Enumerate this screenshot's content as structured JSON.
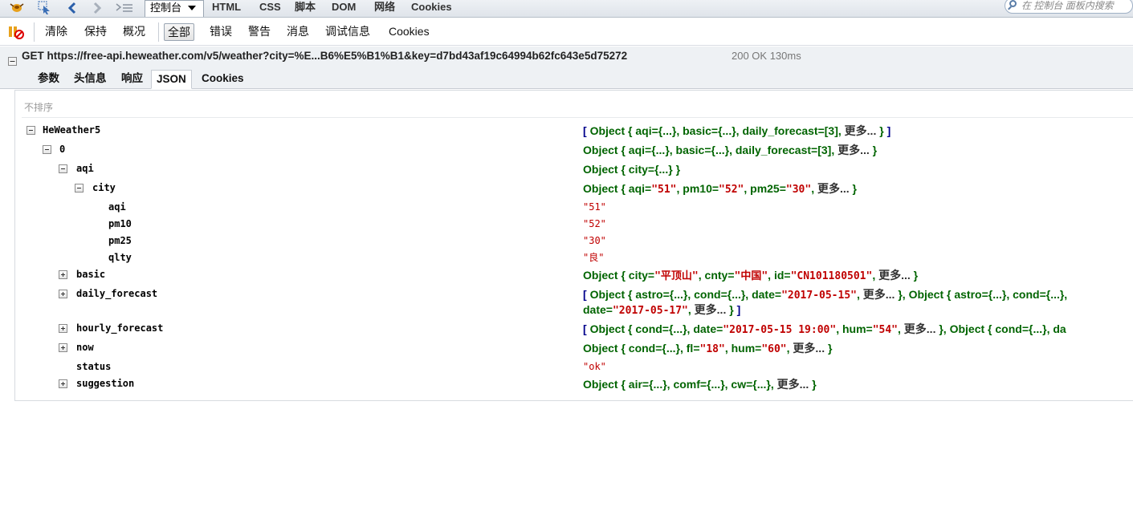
{
  "topbar": {
    "tabs": [
      "控制台",
      "HTML",
      "CSS",
      "脚本",
      "DOM",
      "网络",
      "Cookies"
    ],
    "search_placeholder": "在 控制台 面板内搜索"
  },
  "toolbar": {
    "buttons": [
      "清除",
      "保持",
      "概况",
      "全部",
      "错误",
      "警告",
      "消息",
      "调试信息",
      "Cookies"
    ],
    "active": "全部"
  },
  "request": {
    "line": "GET https://free-api.heweather.com/v5/weather?city=%E...B6%E5%B1%B1&key=d7bd43af19c64994b62fc643e5d75272",
    "status": "200 OK 130ms"
  },
  "subtabs": [
    "参数",
    "头信息",
    "响应",
    "JSON",
    "Cookies"
  ],
  "sort_label": "不排序",
  "tree": {
    "k_heweather": "HeWeather5",
    "v_heweather": [
      "[ ",
      "Object { ",
      "aqi={...}, ",
      "basic={...}, ",
      "daily_forecast=[3], ",
      "更多... ",
      "} ",
      "]"
    ],
    "k_0": "0",
    "v_0": [
      "Object { ",
      "aqi={...}, ",
      "basic={...}, ",
      "daily_forecast=[3], ",
      "更多... ",
      "}"
    ],
    "k_aqi": "aqi",
    "v_aqi": [
      "Object { ",
      "city={...} ",
      "}"
    ],
    "k_city": "city",
    "v_city": [
      "Object { ",
      "aqi=",
      "\"51\"",
      ", ",
      "pm10=",
      "\"52\"",
      ", ",
      "pm25=",
      "\"30\"",
      ", ",
      "更多... ",
      "}"
    ],
    "k_aqi2": "aqi",
    "v_aqi2": "\"51\"",
    "k_pm10": "pm10",
    "v_pm10": "\"52\"",
    "k_pm25": "pm25",
    "v_pm25": "\"30\"",
    "k_qlty": "qlty",
    "v_qlty": "\"良\"",
    "k_basic": "basic",
    "v_basic": [
      "Object { ",
      "city=",
      "\"平顶山\"",
      ", ",
      "cnty=",
      "\"中国\"",
      ", ",
      "id=",
      "\"CN101180501\"",
      ", ",
      "更多... ",
      "}"
    ],
    "k_daily": "daily_forecast",
    "v_daily_1": [
      "[ ",
      "Object { ",
      "astro={...}, ",
      "cond={...}, ",
      "date=",
      "\"2017-05-15\"",
      ", ",
      "更多... ",
      "}, ",
      "Object { ",
      "astro={...}, ",
      "cond={...}, "
    ],
    "v_daily_2": [
      "date=",
      "\"2017-05-17\"",
      ", ",
      "更多... ",
      "} ",
      "]"
    ],
    "k_hourly": "hourly_forecast",
    "v_hourly": [
      "[ ",
      "Object { ",
      "cond={...}, ",
      "date=",
      "\"2017-05-15 19:00\"",
      ", ",
      "hum=",
      "\"54\"",
      ", ",
      "更多... ",
      "}, ",
      "Object { ",
      "cond={...}, ",
      "da"
    ],
    "k_now": "now",
    "v_now": [
      "Object { ",
      "cond={...}, ",
      "fl=",
      "\"18\"",
      ", ",
      "hum=",
      "\"60\"",
      ", ",
      "更多... ",
      "}"
    ],
    "k_status": "status",
    "v_status": "\"ok\"",
    "k_suggestion": "suggestion",
    "v_suggestion": [
      "Object { ",
      "air={...}, ",
      "comf={...}, ",
      "cw={...}, ",
      "更多... ",
      "}"
    ]
  }
}
